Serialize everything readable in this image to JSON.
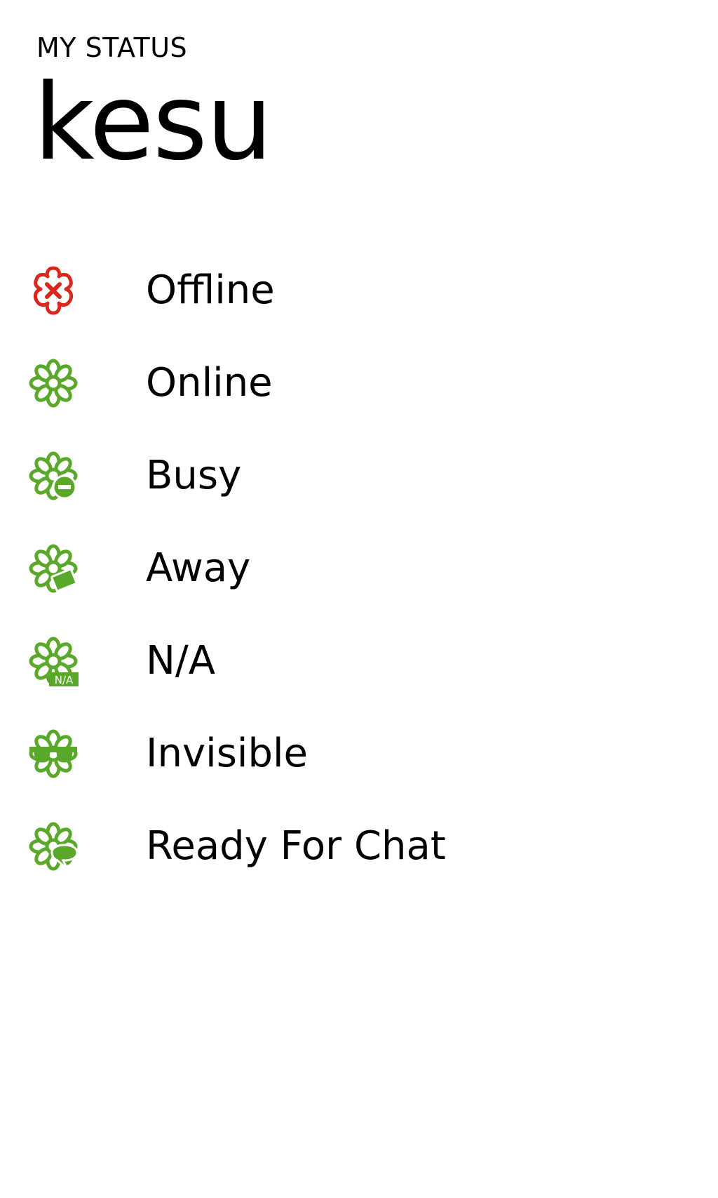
{
  "header": {
    "app_title": "MY STATUS",
    "page_title": "kesu"
  },
  "colors": {
    "online_green": "#5aa82a",
    "offline_red": "#d8281e"
  },
  "statuses": [
    {
      "label": "Offline",
      "icon": "offline-flower-icon",
      "color": "#d8281e"
    },
    {
      "label": "Online",
      "icon": "online-flower-icon",
      "color": "#5aa82a"
    },
    {
      "label": "Busy",
      "icon": "busy-flower-icon",
      "color": "#5aa82a"
    },
    {
      "label": "Away",
      "icon": "away-flower-icon",
      "color": "#5aa82a"
    },
    {
      "label": "N/A",
      "icon": "na-flower-icon",
      "badge": "N/A",
      "color": "#5aa82a"
    },
    {
      "label": "Invisible",
      "icon": "invisible-flower-icon",
      "color": "#5aa82a"
    },
    {
      "label": "Ready For Chat",
      "icon": "ready-for-chat-flower-icon",
      "color": "#5aa82a"
    }
  ]
}
